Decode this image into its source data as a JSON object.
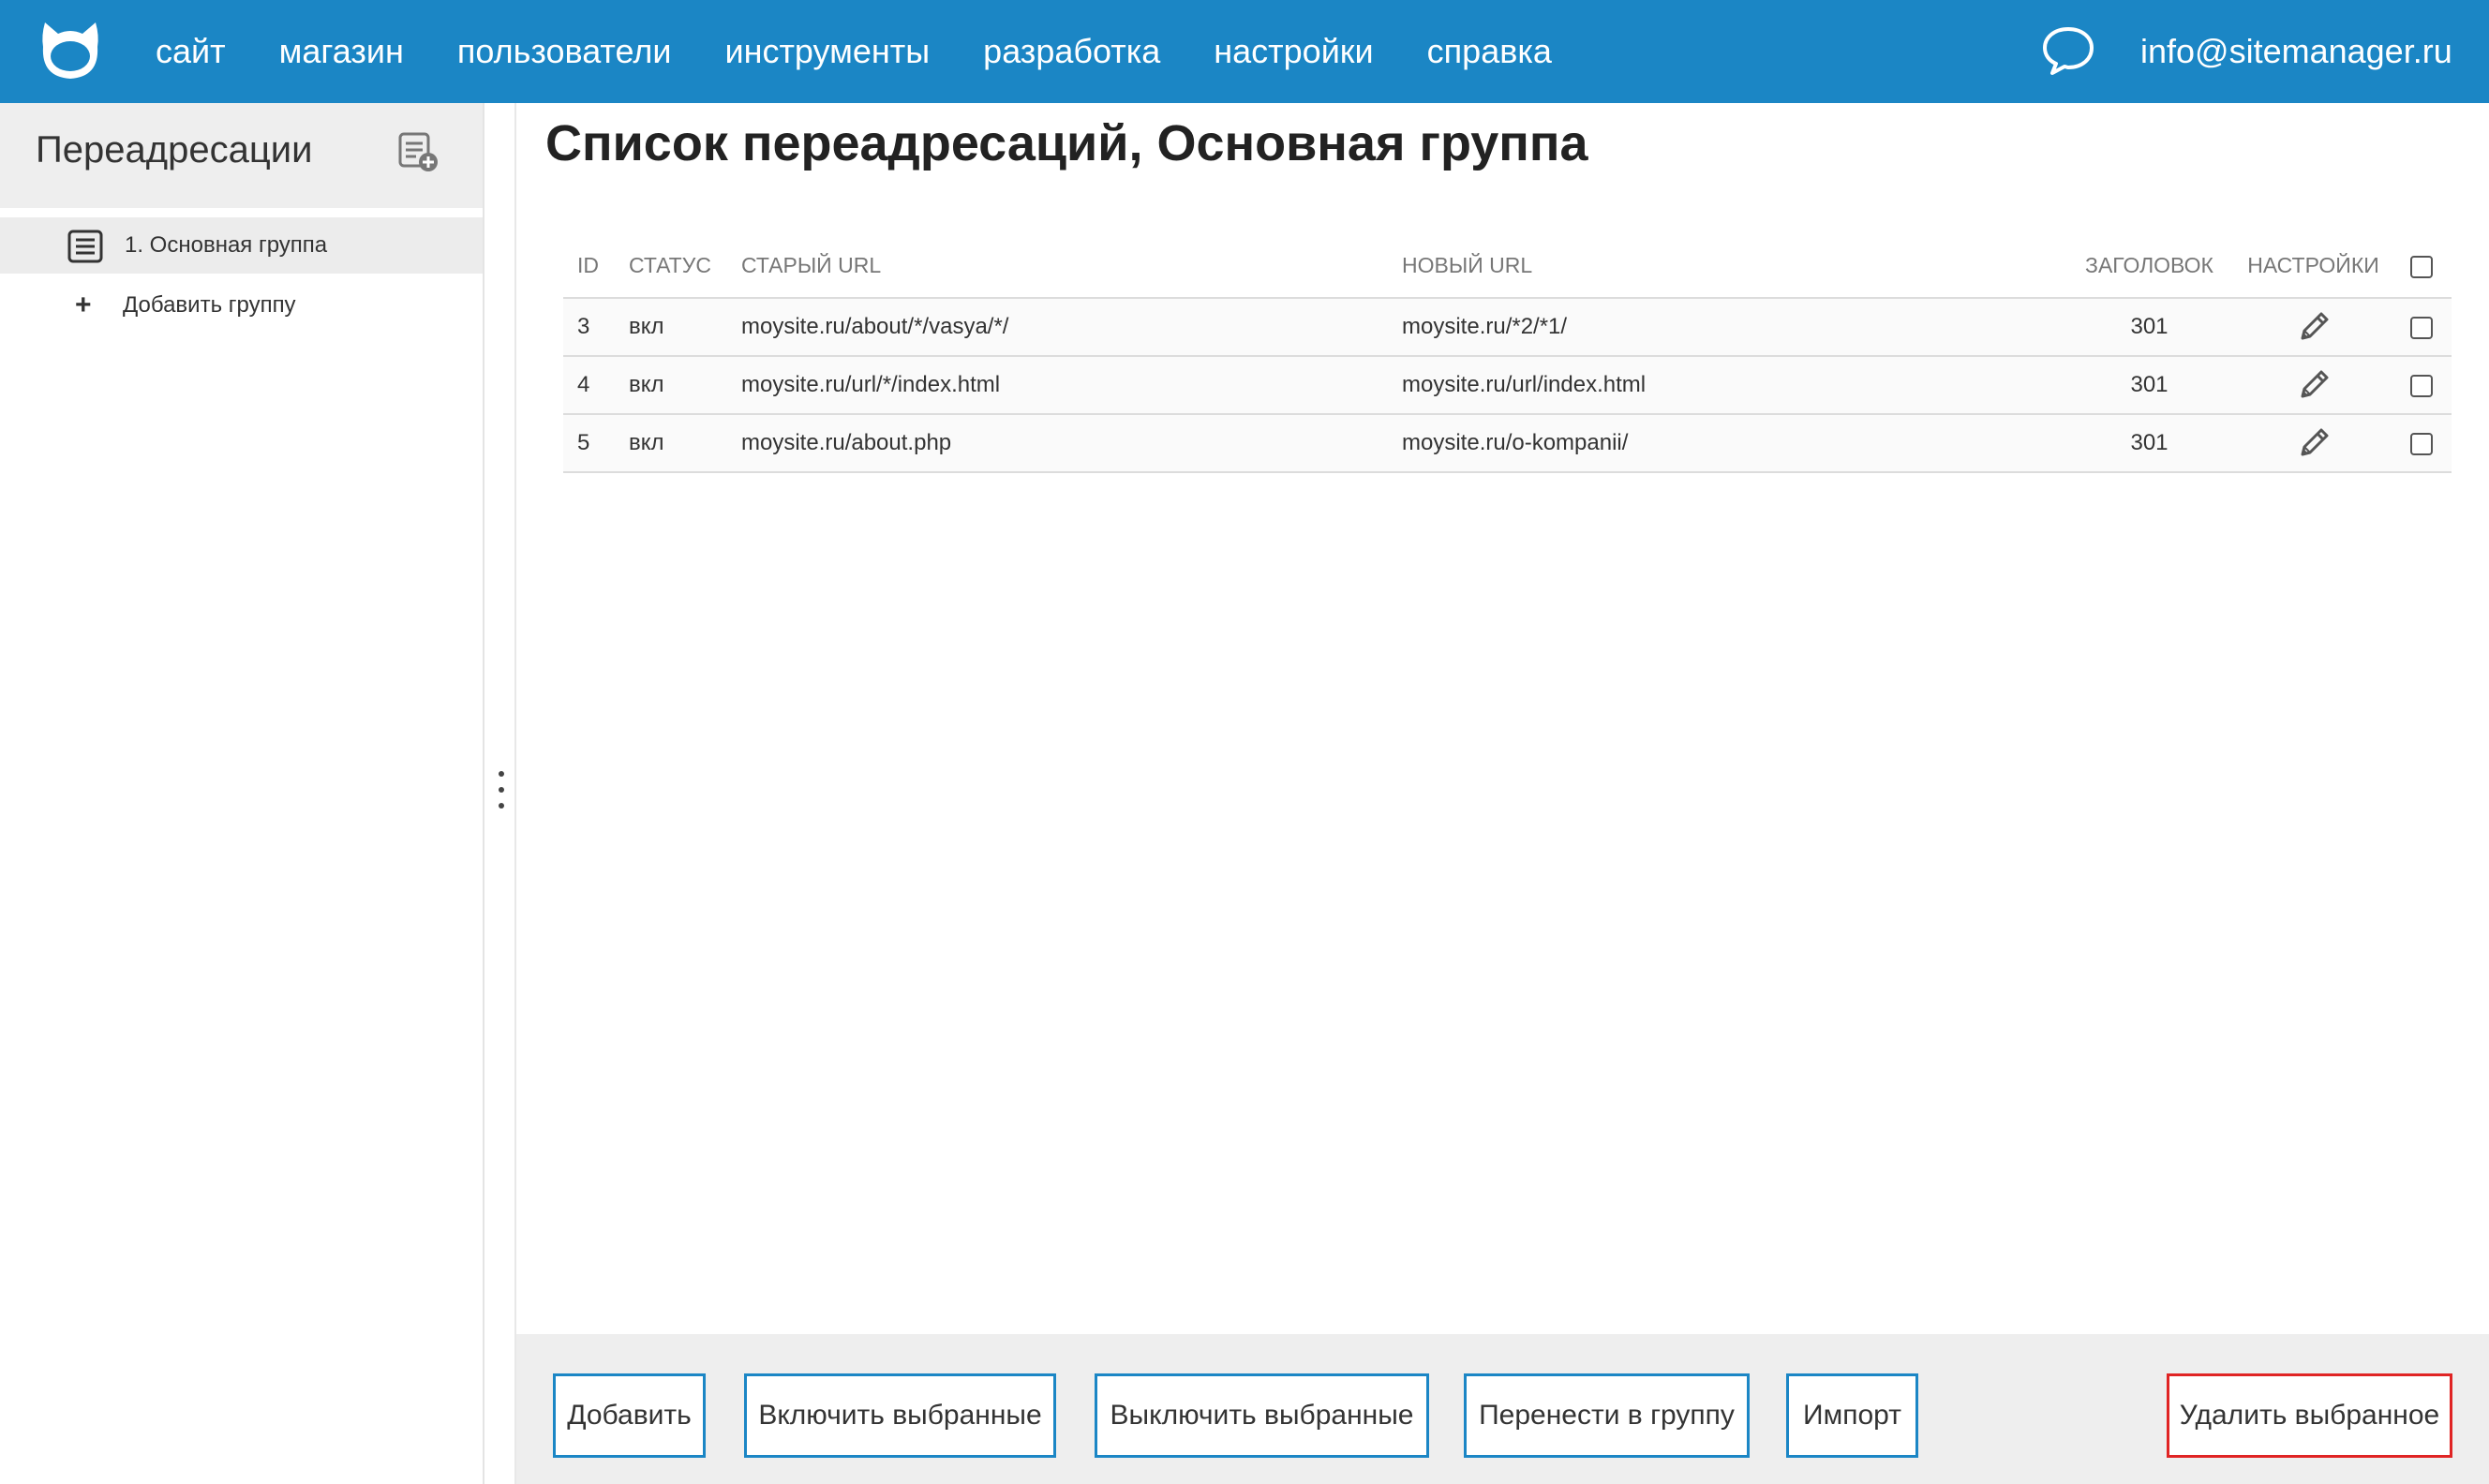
{
  "topbar": {
    "nav": [
      "сайт",
      "магазин",
      "пользователи",
      "инструменты",
      "разработка",
      "настройки",
      "справка"
    ],
    "email": "info@sitemanager.ru"
  },
  "sidebar": {
    "title": "Переадресации",
    "groups": [
      {
        "label": "1. Основная группа"
      }
    ],
    "add_group_label": "Добавить группу"
  },
  "main": {
    "title": "Список переадресаций, Основная группа",
    "table": {
      "headers": {
        "id": "ID",
        "status": "СТАТУС",
        "old_url": "СТАРЫЙ URL",
        "new_url": "НОВЫЙ URL",
        "code": "ЗАГОЛОВОК",
        "settings": "НАСТРОЙКИ"
      },
      "rows": [
        {
          "id": "3",
          "status": "вкл",
          "old_url": "moysite.ru/about/*/vasya/*/",
          "new_url": "moysite.ru/*2/*1/",
          "code": "301"
        },
        {
          "id": "4",
          "status": "вкл",
          "old_url": "moysite.ru/url/*/index.html",
          "new_url": "moysite.ru/url/index.html",
          "code": "301"
        },
        {
          "id": "5",
          "status": "вкл",
          "old_url": "moysite.ru/about.php",
          "new_url": "moysite.ru/o-kompanii/",
          "code": "301"
        }
      ]
    }
  },
  "toolbar": {
    "add": "Добавить",
    "enable_selected": "Включить выбранные",
    "disable_selected": "Выключить выбранные",
    "move_to_group": "Перенести в группу",
    "import": "Импорт",
    "delete_selected": "Удалить выбранное"
  },
  "colors": {
    "topbar": "#1b86c5",
    "status_on": "#3c9a2a",
    "danger": "#e02424"
  }
}
